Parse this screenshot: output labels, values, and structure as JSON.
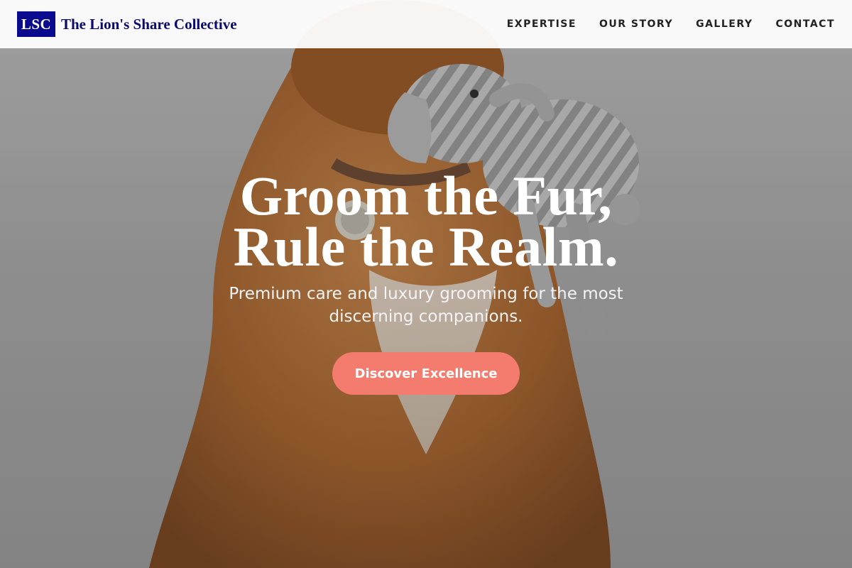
{
  "brand": {
    "mark": "LSC",
    "name": "The Lion's Share Collective",
    "accent_color": "#0a0a8f"
  },
  "nav": {
    "items": [
      {
        "label": "EXPERTISE"
      },
      {
        "label": "OUR STORY"
      },
      {
        "label": "GALLERY"
      },
      {
        "label": "CONTACT"
      }
    ]
  },
  "hero": {
    "title_line_1": "Groom the Fur,",
    "title_line_2": "Rule the Realm.",
    "subtitle": "Premium care and luxury grooming for the most discerning companions.",
    "cta_label": "Discover Excellence",
    "cta_color": "#f47c6e"
  },
  "icons": {
    "hero_image": "dog-with-plush-elephant-photo"
  }
}
